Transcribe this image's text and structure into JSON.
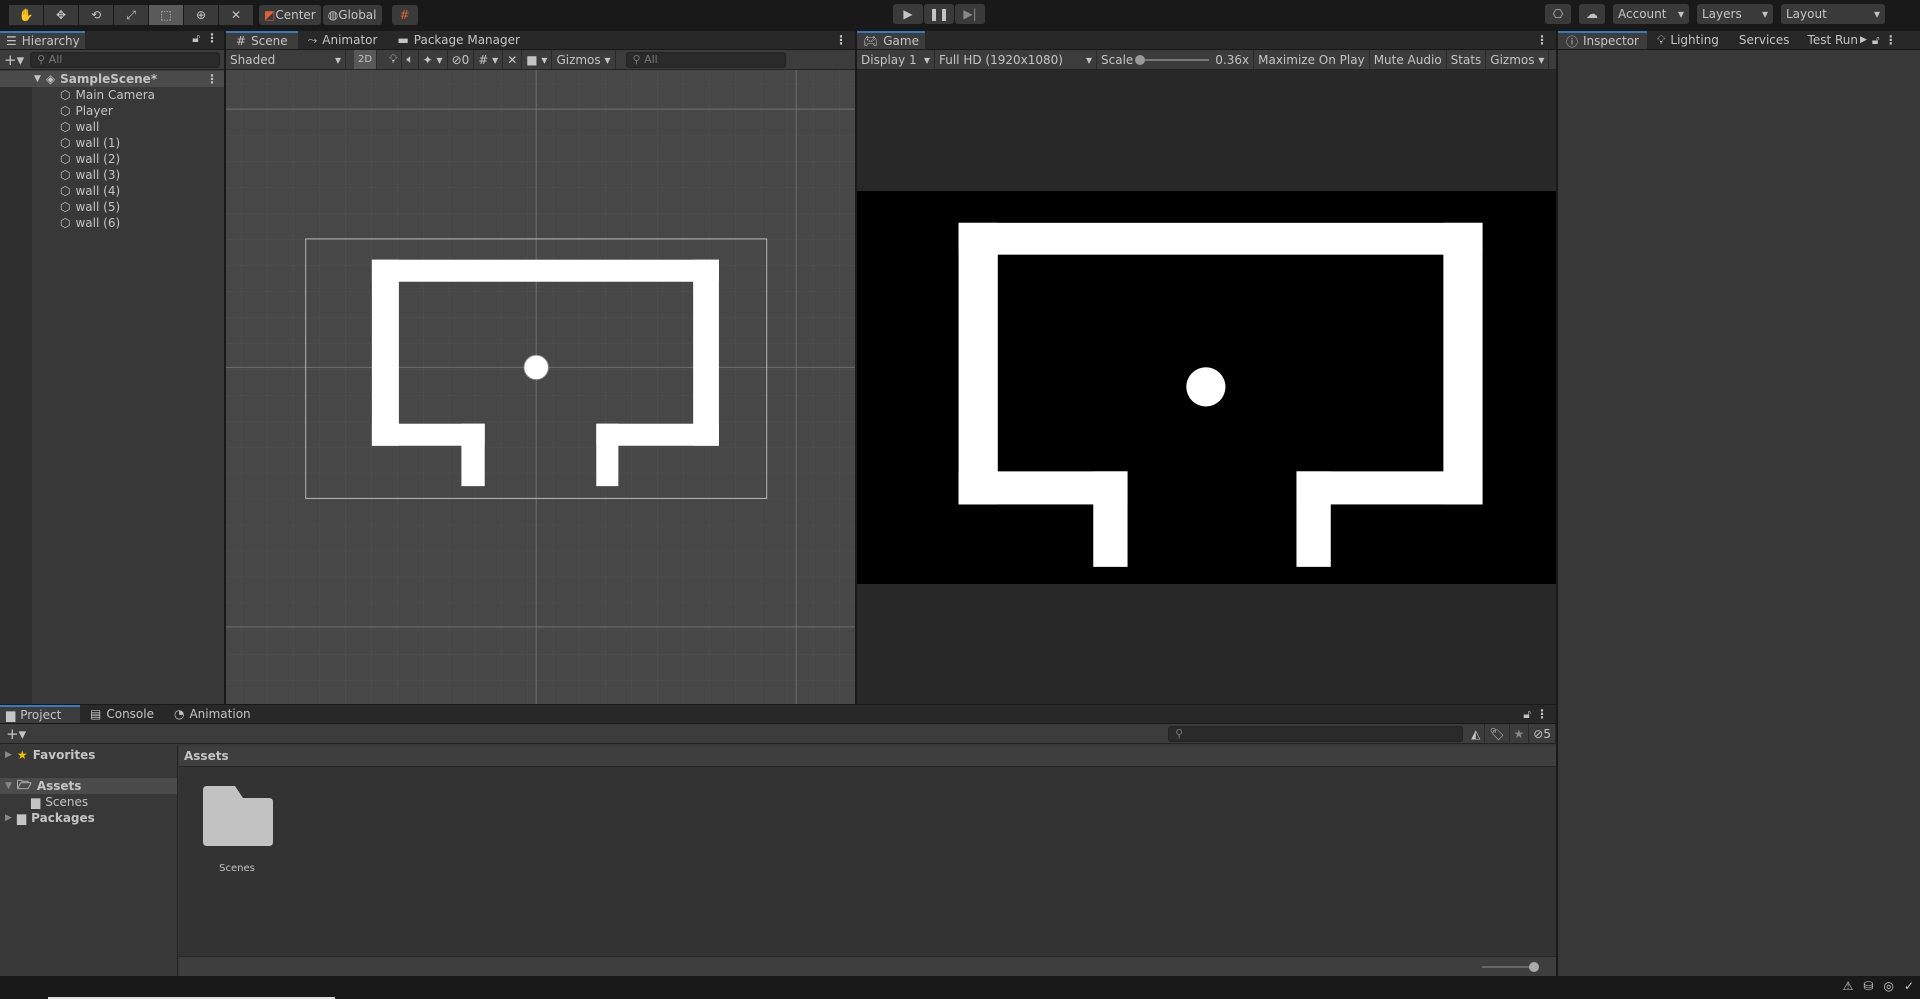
{
  "toolbar": {
    "tools": [
      "hand-tool",
      "move-tool",
      "rotate-tool",
      "scale-tool",
      "rect-tool",
      "transform-tool",
      "custom-tool"
    ],
    "active_tool": "rect-tool",
    "pivot_label": "Center",
    "space_label": "Global",
    "account_label": "Account",
    "layers_label": "Layers",
    "layout_label": "Layout"
  },
  "hierarchy": {
    "tab_label": "Hierarchy",
    "search_placeholder": "All",
    "scene": "SampleScene*",
    "items": [
      "Main Camera",
      "Player",
      "wall",
      "wall (1)",
      "wall (2)",
      "wall (3)",
      "wall (4)",
      "wall (5)",
      "wall (6)"
    ]
  },
  "scene": {
    "tabs": [
      "Scene",
      "Animator",
      "Package Manager"
    ],
    "shading": "Shaded",
    "mode_2d": "2D",
    "hidden_count": "0",
    "gizmos": "Gizmos",
    "search_placeholder": "All"
  },
  "game": {
    "tab_label": "Game",
    "display": "Display 1",
    "resolution": "Full HD (1920x1080)",
    "scale_label": "Scale",
    "scale_value": "0.36x",
    "scale_fraction": 0.0,
    "maximize": "Maximize On Play",
    "mute": "Mute Audio",
    "stats": "Stats",
    "gizmos": "Gizmos"
  },
  "inspector": {
    "tabs": [
      "Inspector",
      "Lighting",
      "Services",
      "Test Run"
    ]
  },
  "project": {
    "tabs": [
      "Project",
      "Console",
      "Animation"
    ],
    "tree": {
      "favorites": "Favorites",
      "assets": "Assets",
      "scenes": "Scenes",
      "packages": "Packages"
    },
    "breadcrumb": "Assets",
    "hidden_count": "5",
    "items": [
      {
        "name": "Scenes",
        "icon": "folder-icon"
      }
    ]
  },
  "colors": {
    "accent": "#3a79bb",
    "game_bg": "#000000",
    "wall": "#ffffff",
    "scene_bg": "#474747"
  }
}
